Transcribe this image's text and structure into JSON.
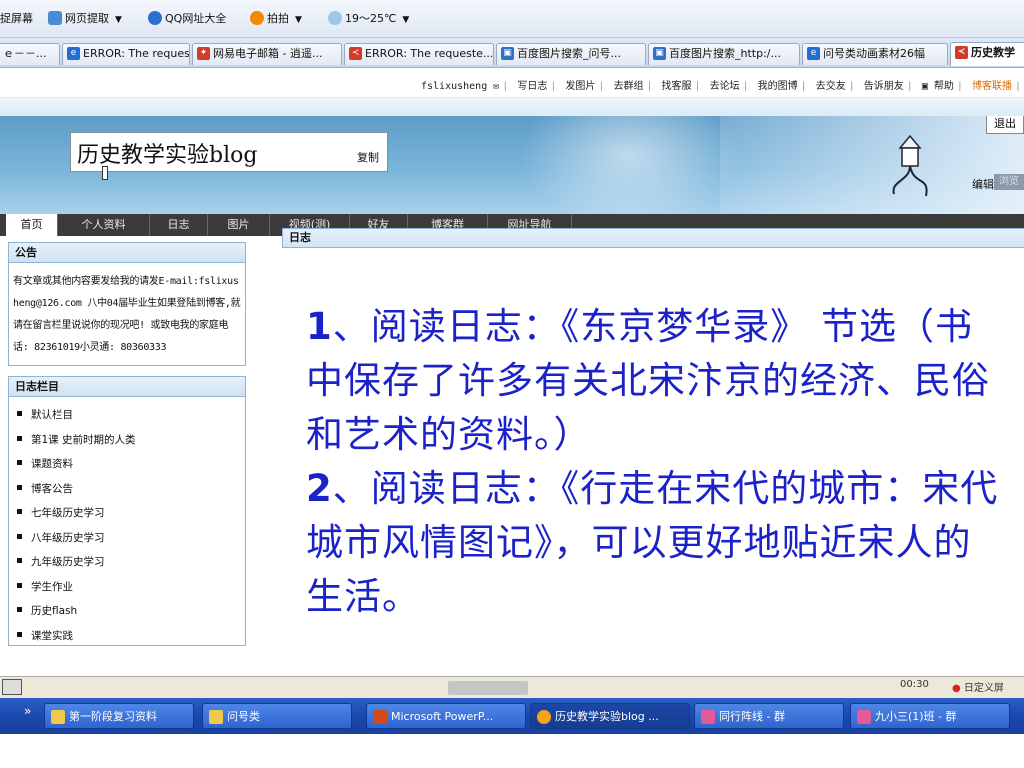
{
  "browser_toolbar": {
    "items": [
      "捉屏幕",
      "网页提取",
      "QQ网址大全",
      "拍拍",
      "19～25℃"
    ]
  },
  "tabs": [
    {
      "label": "ｅ－－..."
    },
    {
      "label": "ERROR: The requeste..."
    },
    {
      "label": "网易电子邮箱 - 逍遥..."
    },
    {
      "label": "ERROR: The requeste..."
    },
    {
      "label": "百度图片搜索_问号..."
    },
    {
      "label": "百度图片搜索_http:/..."
    },
    {
      "label": "问号类动画素材26幅"
    },
    {
      "label": "历史教学"
    }
  ],
  "topnav": {
    "user": "fslixusheng",
    "links": [
      "写日志",
      "发图片",
      "去群组",
      "找客服",
      "去论坛",
      "我的图博",
      "去交友",
      "告诉朋友",
      "帮助",
      "博客联播"
    ]
  },
  "banner": {
    "title": "历史教学实验blog",
    "copy_label": "复制",
    "logout_label": "退出",
    "edit_label": "编辑",
    "browse_label": "浏览"
  },
  "mainnav": [
    "首页",
    "个人资料",
    "日志",
    "图片",
    "视频(测)",
    "好友",
    "博客群",
    "网址导航"
  ],
  "sidebar": {
    "notice_title": "公告",
    "notice_text": "有文章或其他内容要发给我的请发E-mail:fslixusheng@126.com 八中04届毕业生如果登陆到博客,就请在留言栏里说说你的现况吧! 或致电我的家庭电话: 82361019小灵通: 80360333",
    "categories_title": "日志栏目",
    "categories": [
      "默认栏目",
      "第1课 史前时期的人类",
      "课题资料",
      "博客公告",
      "七年级历史学习",
      "八年级历史学习",
      "九年级历史学习",
      "学生作业",
      "历史flash",
      "课堂实践"
    ]
  },
  "content": {
    "header": "日志",
    "item1_num": "1",
    "item1_text": "、阅读日志：《东京梦华录》 节选（书中保存了许多有关北宋汴京的经济、民俗和艺术的资料。）",
    "item2_num": "2",
    "item2_text": "、阅读日志：《行走在宋代的城市：宋代城市风情图记》，可以更好地贴近宋人的生活。"
  },
  "statusbar": {
    "time": "00:30",
    "right_text": "日定义屏"
  },
  "taskbar": [
    {
      "label": "第一阶段复习资料"
    },
    {
      "label": "问号类"
    },
    {
      "label": "Microsoft PowerP..."
    },
    {
      "label": "历史教学实验blog ..."
    },
    {
      "label": "同行阵线 - 群"
    },
    {
      "label": "九小三(1)班 - 群"
    }
  ],
  "colors": {
    "article_text": "#1a22c8",
    "panel_border": "#8fb3d3",
    "nav_bg": "#3b3b3b",
    "taskbar_bg": "#1b48ad"
  }
}
